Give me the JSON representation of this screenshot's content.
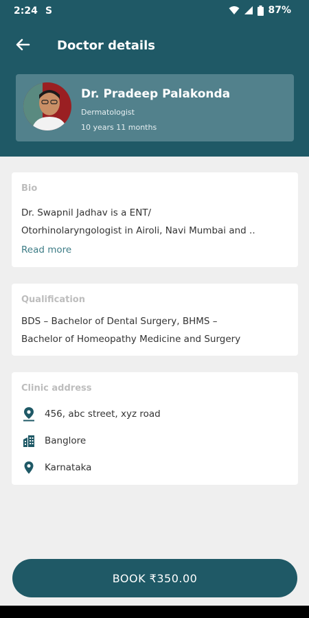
{
  "status_bar": {
    "time": "2:24",
    "notification": "S",
    "battery": "87%"
  },
  "header": {
    "title": "Doctor details"
  },
  "doctor": {
    "name": "Dr. Pradeep Palakonda",
    "specialty": "Dermatologist",
    "experience": "10 years 11 months"
  },
  "bio": {
    "label": "Bio",
    "line1": "Dr. Swapnil Jadhav is a ENT/",
    "line2": "Otorhinolaryngologist in Airoli, Navi Mumbai and ..",
    "read_more": "Read more"
  },
  "qualification": {
    "label": "Qualification",
    "line1": "BDS – Bachelor of Dental Surgery, BHMS –",
    "line2": "Bachelor of Homeopathy Medicine and Surgery"
  },
  "clinic": {
    "label": "Clinic address",
    "items": [
      {
        "icon": "location-pin-icon",
        "text": "456, abc street, xyz road"
      },
      {
        "icon": "city-icon",
        "text": "Banglore"
      },
      {
        "icon": "map-marker-icon",
        "text": "Karnataka"
      }
    ]
  },
  "book_button": {
    "label": "BOOK ₹350.00"
  },
  "colors": {
    "primary": "#1f5966",
    "card_accent": "#52818c",
    "link": "#3d7c86"
  }
}
